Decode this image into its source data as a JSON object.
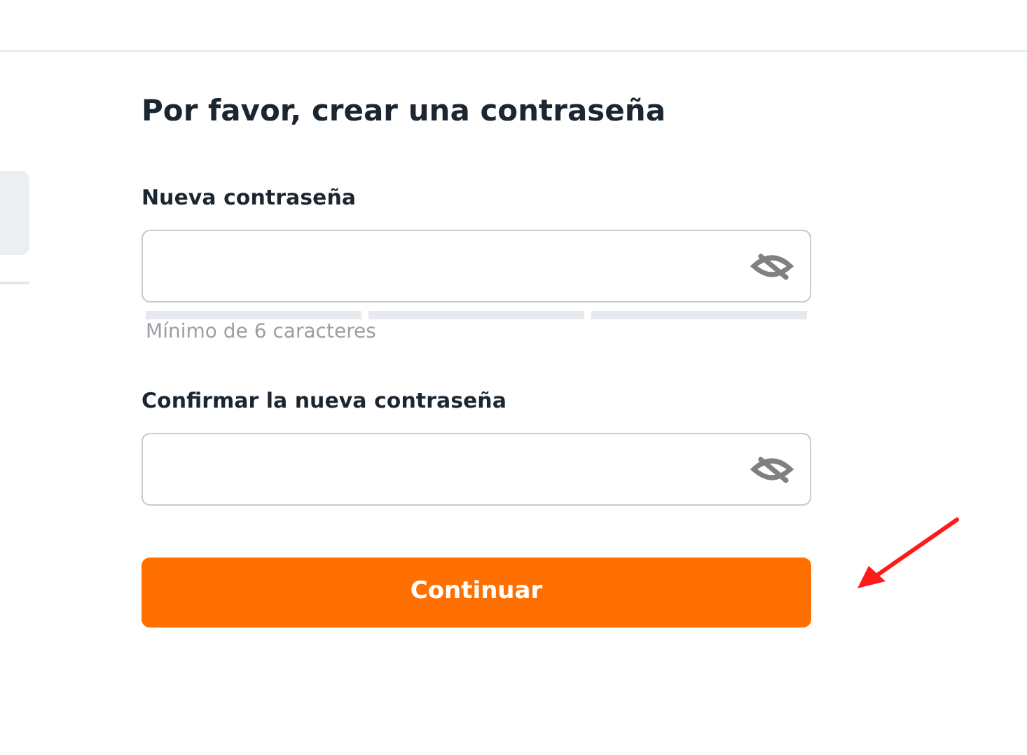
{
  "title": "Por favor, crear una contraseña",
  "fields": [
    {
      "label": "Nueva contraseña",
      "strength": {
        "level": 0,
        "hint": "Mínimo de 6 caracteres"
      }
    },
    {
      "label": "Confirmar la nueva contraseña"
    }
  ],
  "button": "Continuar"
}
